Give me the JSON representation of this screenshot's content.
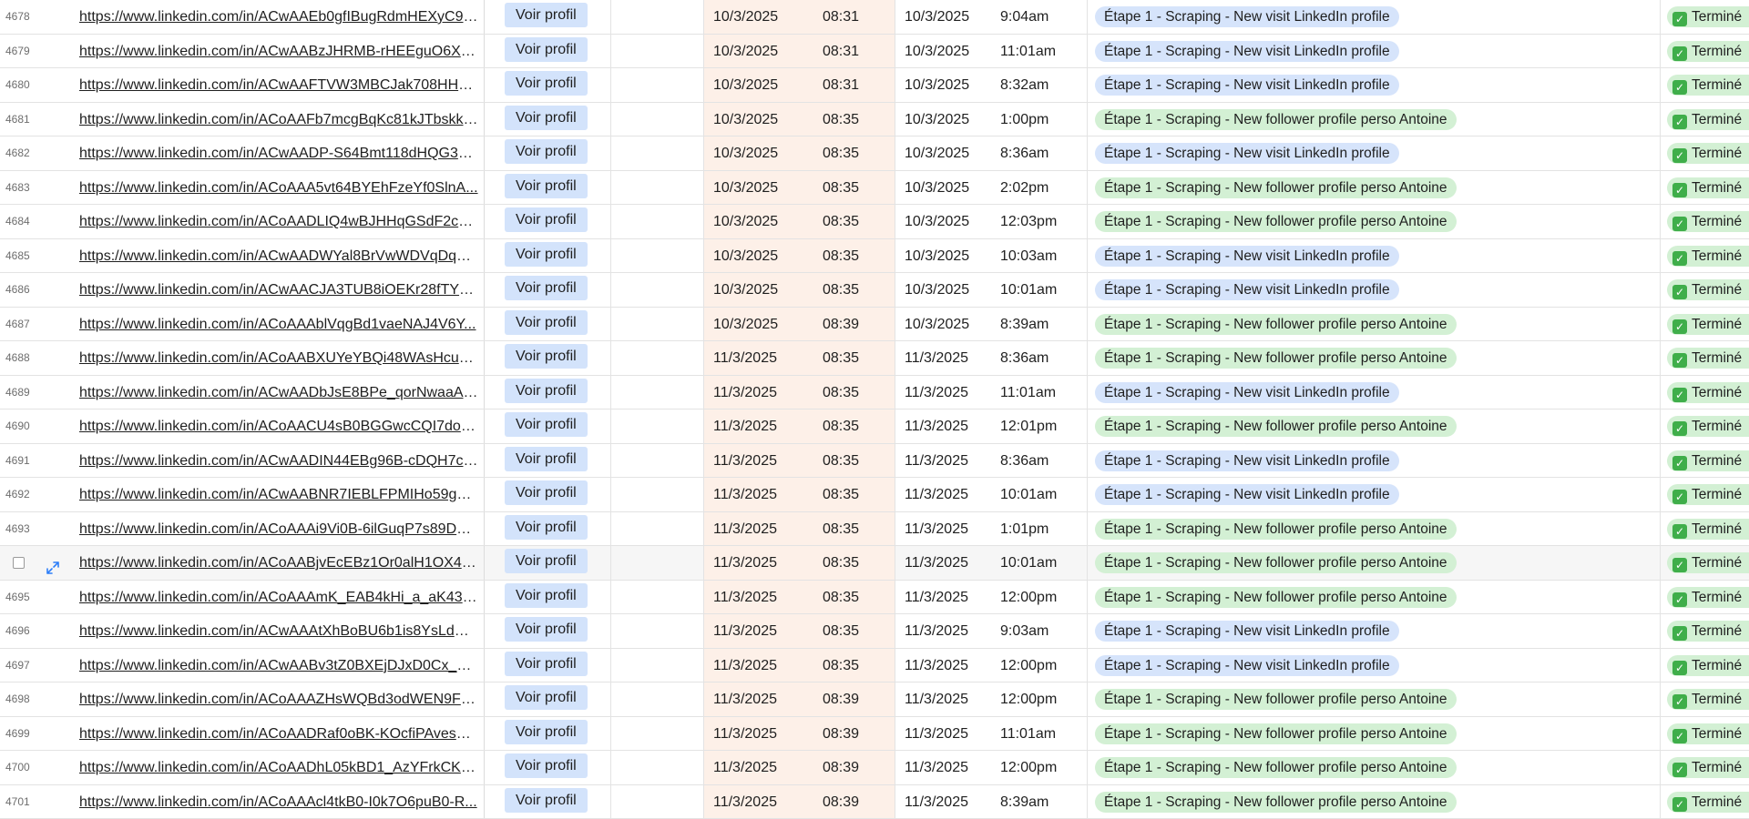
{
  "table": {
    "button_label": "Voir profil",
    "status_label": "Terminé",
    "hovered_row_index": 16,
    "rows": [
      {
        "num": "4678",
        "url": "https://www.linkedin.com/in/ACwAAEb0gfIBugRdmHEXyC9n...",
        "d1": "10/3/2025",
        "t1": "08:31",
        "d2": "10/3/2025",
        "t2": "9:04am",
        "tag": "Étape 1 - Scraping - New visit LinkedIn profile",
        "kind": "visit"
      },
      {
        "num": "4679",
        "url": "https://www.linkedin.com/in/ACwAABzJHRMB-rHEEguO6Xyf...",
        "d1": "10/3/2025",
        "t1": "08:31",
        "d2": "10/3/2025",
        "t2": "11:01am",
        "tag": "Étape 1 - Scraping - New visit LinkedIn profile",
        "kind": "visit"
      },
      {
        "num": "4680",
        "url": "https://www.linkedin.com/in/ACwAAFTVW3MBCJak708HHZ...",
        "d1": "10/3/2025",
        "t1": "08:31",
        "d2": "10/3/2025",
        "t2": "8:32am",
        "tag": "Étape 1 - Scraping - New visit LinkedIn profile",
        "kind": "visit"
      },
      {
        "num": "4681",
        "url": "https://www.linkedin.com/in/ACoAAFb7mcgBqKc81kJTbskkF...",
        "d1": "10/3/2025",
        "t1": "08:35",
        "d2": "10/3/2025",
        "t2": "1:00pm",
        "tag": "Étape 1 - Scraping - New follower profile perso Antoine",
        "kind": "follower"
      },
      {
        "num": "4682",
        "url": "https://www.linkedin.com/in/ACwAADP-S64Bmt118dHQG3n...",
        "d1": "10/3/2025",
        "t1": "08:35",
        "d2": "10/3/2025",
        "t2": "8:36am",
        "tag": "Étape 1 - Scraping - New visit LinkedIn profile",
        "kind": "visit"
      },
      {
        "num": "4683",
        "url": "https://www.linkedin.com/in/ACoAAA5vt64BYEhFzeYf0SlnA...",
        "d1": "10/3/2025",
        "t1": "08:35",
        "d2": "10/3/2025",
        "t2": "2:02pm",
        "tag": "Étape 1 - Scraping - New follower profile perso Antoine",
        "kind": "follower"
      },
      {
        "num": "4684",
        "url": "https://www.linkedin.com/in/ACoAADLIQ4wBJHHqGSdF2cW...",
        "d1": "10/3/2025",
        "t1": "08:35",
        "d2": "10/3/2025",
        "t2": "12:03pm",
        "tag": "Étape 1 - Scraping - New follower profile perso Antoine",
        "kind": "follower"
      },
      {
        "num": "4685",
        "url": "https://www.linkedin.com/in/ACwAADWYal8BrVwWDVqDqX3...",
        "d1": "10/3/2025",
        "t1": "08:35",
        "d2": "10/3/2025",
        "t2": "10:03am",
        "tag": "Étape 1 - Scraping - New visit LinkedIn profile",
        "kind": "visit"
      },
      {
        "num": "4686",
        "url": "https://www.linkedin.com/in/ACwAACJA3TUB8iOEKr28fTY_...",
        "d1": "10/3/2025",
        "t1": "08:35",
        "d2": "10/3/2025",
        "t2": "10:01am",
        "tag": "Étape 1 - Scraping - New visit LinkedIn profile",
        "kind": "visit"
      },
      {
        "num": "4687",
        "url": "https://www.linkedin.com/in/ACoAAAblVqgBd1vaeNAJ4V6Y...",
        "d1": "10/3/2025",
        "t1": "08:39",
        "d2": "10/3/2025",
        "t2": "8:39am",
        "tag": "Étape 1 - Scraping - New follower profile perso Antoine",
        "kind": "follower"
      },
      {
        "num": "4688",
        "url": "https://www.linkedin.com/in/ACoAABXUYeYBQi48WAsHcue...",
        "d1": "11/3/2025",
        "t1": "08:35",
        "d2": "11/3/2025",
        "t2": "8:36am",
        "tag": "Étape 1 - Scraping - New follower profile perso Antoine",
        "kind": "follower"
      },
      {
        "num": "4689",
        "url": "https://www.linkedin.com/in/ACwAADbJsE8BPe_qorNwaaAs...",
        "d1": "11/3/2025",
        "t1": "08:35",
        "d2": "11/3/2025",
        "t2": "11:01am",
        "tag": "Étape 1 - Scraping - New visit LinkedIn profile",
        "kind": "visit"
      },
      {
        "num": "4690",
        "url": "https://www.linkedin.com/in/ACoAACU4sB0BGGwcCQI7dob...",
        "d1": "11/3/2025",
        "t1": "08:35",
        "d2": "11/3/2025",
        "t2": "12:01pm",
        "tag": "Étape 1 - Scraping - New follower profile perso Antoine",
        "kind": "follower"
      },
      {
        "num": "4691",
        "url": "https://www.linkedin.com/in/ACwAADIN44EBg96B-cDQH7c7...",
        "d1": "11/3/2025",
        "t1": "08:35",
        "d2": "11/3/2025",
        "t2": "8:36am",
        "tag": "Étape 1 - Scraping - New visit LinkedIn profile",
        "kind": "visit"
      },
      {
        "num": "4692",
        "url": "https://www.linkedin.com/in/ACwAABNR7IEBLFPMIHo59gAy...",
        "d1": "11/3/2025",
        "t1": "08:35",
        "d2": "11/3/2025",
        "t2": "10:01am",
        "tag": "Étape 1 - Scraping - New visit LinkedIn profile",
        "kind": "visit"
      },
      {
        "num": "4693",
        "url": "https://www.linkedin.com/in/ACoAAAi9Vi0B-6ilGuqP7s89DD...",
        "d1": "11/3/2025",
        "t1": "08:35",
        "d2": "11/3/2025",
        "t2": "1:01pm",
        "tag": "Étape 1 - Scraping - New follower profile perso Antoine",
        "kind": "follower"
      },
      {
        "num": "",
        "url": "https://www.linkedin.com/in/ACoAABjvEcEBz1Or0alH1OX4h...",
        "d1": "11/3/2025",
        "t1": "08:35",
        "d2": "11/3/2025",
        "t2": "10:01am",
        "tag": "Étape 1 - Scraping - New follower profile perso Antoine",
        "kind": "follower"
      },
      {
        "num": "4695",
        "url": "https://www.linkedin.com/in/ACoAAAmK_EAB4kHi_a_aK43U...",
        "d1": "11/3/2025",
        "t1": "08:35",
        "d2": "11/3/2025",
        "t2": "12:00pm",
        "tag": "Étape 1 - Scraping - New follower profile perso Antoine",
        "kind": "follower"
      },
      {
        "num": "4696",
        "url": "https://www.linkedin.com/in/ACwAAAtXhBoBU6b1is8YsLdDA...",
        "d1": "11/3/2025",
        "t1": "08:35",
        "d2": "11/3/2025",
        "t2": "9:03am",
        "tag": "Étape 1 - Scraping - New visit LinkedIn profile",
        "kind": "visit"
      },
      {
        "num": "4697",
        "url": "https://www.linkedin.com/in/ACwAABv3tZ0BXEjDJxD0Cx_C...",
        "d1": "11/3/2025",
        "t1": "08:35",
        "d2": "11/3/2025",
        "t2": "12:00pm",
        "tag": "Étape 1 - Scraping - New visit LinkedIn profile",
        "kind": "visit"
      },
      {
        "num": "4698",
        "url": "https://www.linkedin.com/in/ACoAAAZHsWQBd3odWEN9F8...",
        "d1": "11/3/2025",
        "t1": "08:39",
        "d2": "11/3/2025",
        "t2": "12:00pm",
        "tag": "Étape 1 - Scraping - New follower profile perso Antoine",
        "kind": "follower"
      },
      {
        "num": "4699",
        "url": "https://www.linkedin.com/in/ACoAADRaf0oBK-KOcfiPAveswv...",
        "d1": "11/3/2025",
        "t1": "08:39",
        "d2": "11/3/2025",
        "t2": "11:01am",
        "tag": "Étape 1 - Scraping - New follower profile perso Antoine",
        "kind": "follower"
      },
      {
        "num": "4700",
        "url": "https://www.linkedin.com/in/ACoAADhL05kBD1_AzYFrkCKR...",
        "d1": "11/3/2025",
        "t1": "08:39",
        "d2": "11/3/2025",
        "t2": "12:00pm",
        "tag": "Étape 1 - Scraping - New follower profile perso Antoine",
        "kind": "follower"
      },
      {
        "num": "4701",
        "url": "https://www.linkedin.com/in/ACoAAAcl4tkB0-I0k7O6puB0-R...",
        "d1": "11/3/2025",
        "t1": "08:39",
        "d2": "11/3/2025",
        "t2": "8:39am",
        "tag": "Étape 1 - Scraping - New follower profile perso Antoine",
        "kind": "follower"
      }
    ]
  }
}
